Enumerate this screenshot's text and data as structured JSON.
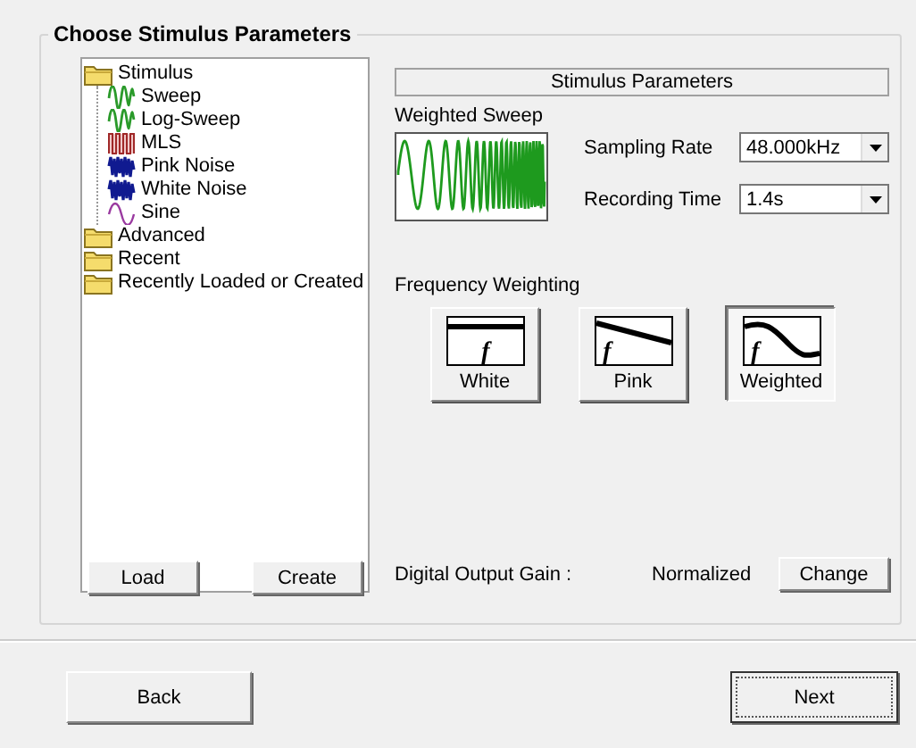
{
  "group": {
    "title": "Choose Stimulus Parameters"
  },
  "tree": [
    {
      "label": "Stimulus",
      "kind": "folder",
      "children": [
        {
          "label": "Sweep",
          "kind": "sweep"
        },
        {
          "label": "Log-Sweep",
          "kind": "sweep"
        },
        {
          "label": "MLS",
          "kind": "mls"
        },
        {
          "label": "Pink Noise",
          "kind": "noise"
        },
        {
          "label": "White Noise",
          "kind": "noise"
        },
        {
          "label": "Sine",
          "kind": "sine"
        }
      ]
    },
    {
      "label": "Advanced",
      "kind": "folder"
    },
    {
      "label": "Recent",
      "kind": "folder"
    },
    {
      "label": "Recently Loaded or Created",
      "kind": "folder"
    }
  ],
  "tree_buttons": [
    "Load",
    "Create"
  ],
  "parameters": {
    "header": "Stimulus Parameters",
    "stimulus_name": "Weighted Sweep",
    "fields": [
      {
        "label": "Sampling Rate",
        "value": "48.000kHz"
      },
      {
        "label": "Recording Time",
        "value": "1.4s"
      }
    ]
  },
  "frequency_weighting": {
    "label": "Frequency Weighting",
    "options": [
      {
        "label": "White",
        "kind": "flat",
        "symbol": "f",
        "selected": false
      },
      {
        "label": "Pink",
        "kind": "slope",
        "symbol": "f",
        "selected": false
      },
      {
        "label": "Weighted",
        "kind": "curve",
        "symbol": "f",
        "selected": true
      }
    ]
  },
  "output_gain": {
    "label": "Digital Output Gain :",
    "value": "Normalized",
    "button": "Change"
  },
  "nav": {
    "back": "Back",
    "next": "Next"
  }
}
